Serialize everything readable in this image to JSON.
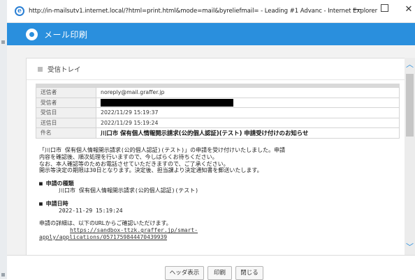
{
  "window": {
    "title": "http://in-mailsutv1.internet.local/?html=print.html&mode=mail&byreliefmail= - Leading #1 Advanc - Internet Explorer",
    "minimize": "—",
    "close": "✕"
  },
  "banner": {
    "title": "メール印刷"
  },
  "folder": {
    "label": "受信トレイ"
  },
  "meta": {
    "from_label": "送信者",
    "from_value": "noreply@mail.graffer.jp",
    "to_label": "受信者",
    "received_label": "受信日",
    "received_value": "2022/11/29 15:19:37",
    "sent_label": "送信日",
    "sent_value": "2022/11/29 15:19:24",
    "subject_label": "件名",
    "subject_value": "川口市 保有個人情報開示請求(公的個人認証)(テスト) 申請受け付けのお知らせ"
  },
  "body": {
    "line1": "「川口市 保有個人情報開示請求(公的個人認証)(テスト)」の申請を受け付けいたしました。申請",
    "line2": "内容を確認後、順次処理を行いますので、今しばらくお待ちください。",
    "line3": "なお、本人確認等のためお電話させていただきますので、ご了承ください。",
    "line4": "開示等決定の期限は30日となります。決定後、担当課より決定通知書を郵送いたします。",
    "type_heading": "■ 申請の種類",
    "type_value": "川口市 保有個人情報開示請求(公的個人認証)(テスト)",
    "date_heading": "■ 申請日時",
    "date_value": "2022-11-29 15:19:24",
    "details": "申請の詳細は、以下のURLからご確認いただけます。",
    "url_line1": "https://sandbox-ttzk.graffer.jp/smart-",
    "url_line2": "apply/applications/0571759844470439939"
  },
  "buttons": {
    "header": "ヘッダ表示",
    "print": "印刷",
    "close": "閉じる"
  },
  "scroll": {
    "up": "︿",
    "down": "﹀"
  }
}
